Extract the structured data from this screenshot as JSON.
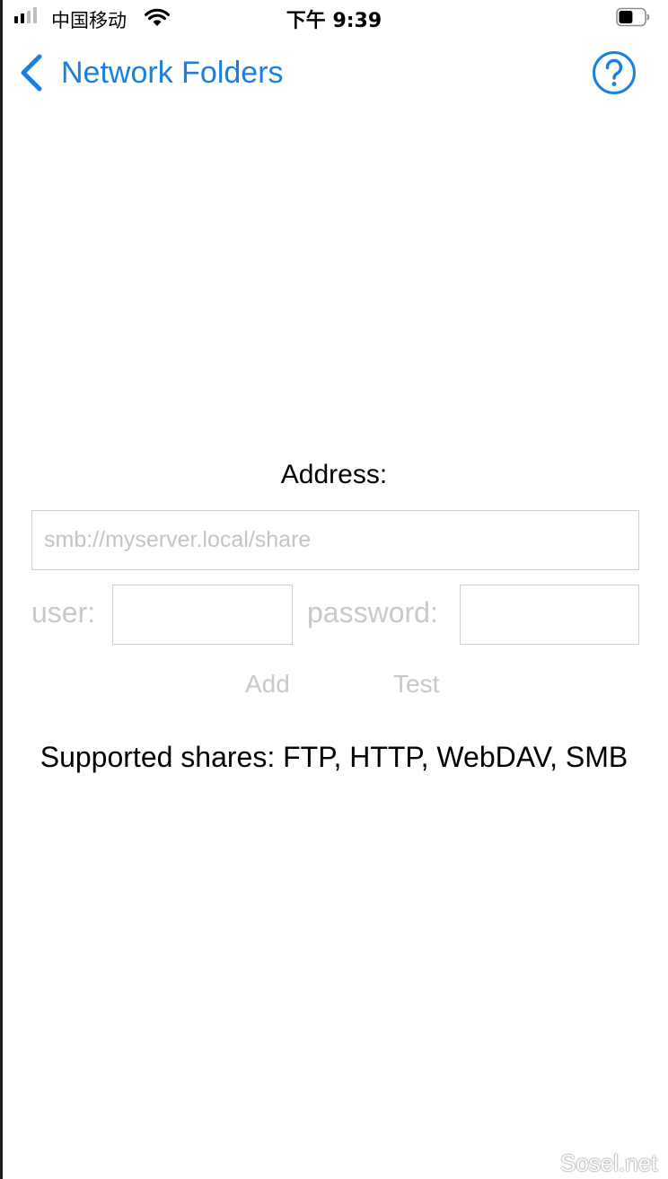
{
  "status_bar": {
    "carrier": "中国移动",
    "time": "下午 9:39",
    "signal_bars": 2,
    "signal_total": 4,
    "wifi_icon": "wifi-icon",
    "battery_icon": "battery-icon",
    "battery_level": 0.55
  },
  "nav": {
    "back_icon": "chevron-left-icon",
    "back_label": "Network Folders",
    "help_icon": "question-circle-icon",
    "accent_color": "#1a7fe0"
  },
  "form": {
    "address_label": "Address:",
    "address_placeholder": "smb://myserver.local/share",
    "address_value": "",
    "user_label": "user:",
    "user_value": "",
    "password_label": "password:",
    "password_value": "",
    "add_label": "Add",
    "test_label": "Test",
    "disabled_color": "#c8c8c8"
  },
  "info": {
    "supported_shares": "Supported shares: FTP, HTTP, WebDAV, SMB"
  },
  "watermark": "Sosel.net"
}
